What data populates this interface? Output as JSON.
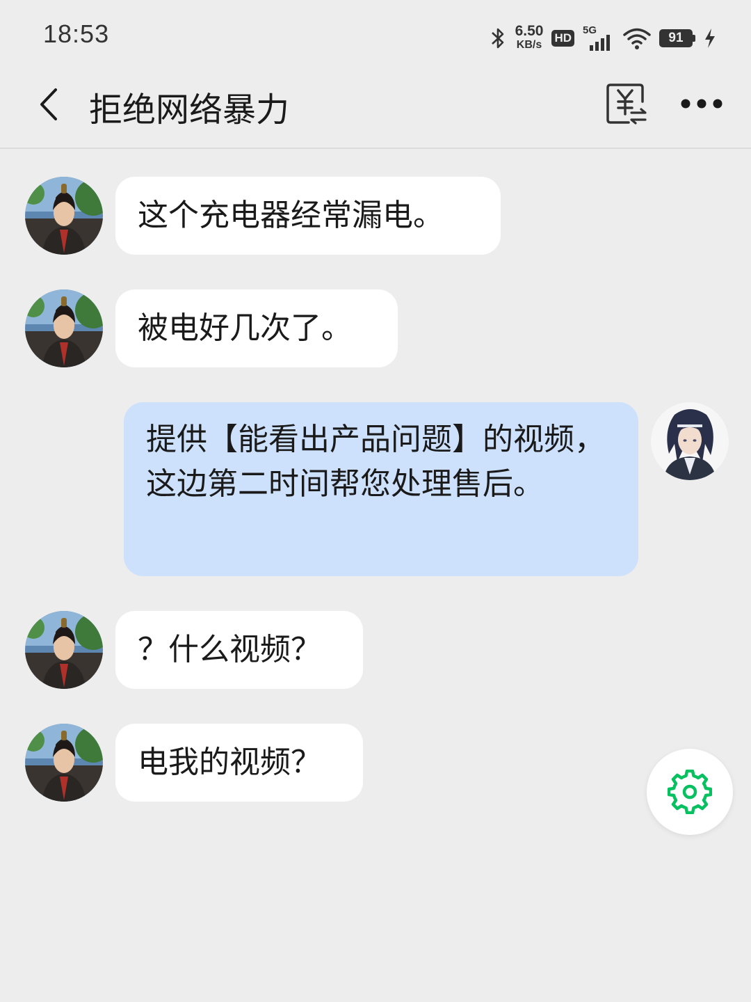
{
  "status_bar": {
    "time": "18:53",
    "net_speed_value": "6.50",
    "net_speed_unit": "KB/s",
    "hd_label": "HD",
    "network_label": "5G",
    "battery_level": "91"
  },
  "header": {
    "title": "拒绝网络暴力"
  },
  "messages": [
    {
      "side": "in",
      "text": "这个充电器经常漏电。"
    },
    {
      "side": "in",
      "text": "被电好几次了。"
    },
    {
      "side": "out",
      "text": "提供【能看出产品问题】的视频，这边第二时间帮您处理售后。"
    },
    {
      "side": "in",
      "text": "？什么视频？"
    },
    {
      "side": "in",
      "text": "电我的视频？"
    }
  ],
  "colors": {
    "background": "#ededed",
    "incoming_bubble": "#ffffff",
    "outgoing_bubble": "#cde0fc",
    "accent_green": "#07c160"
  },
  "icons": {
    "back": "chevron-left-icon",
    "pay": "yuan-transfer-icon",
    "more": "more-dots-icon",
    "settings": "gear-icon"
  }
}
